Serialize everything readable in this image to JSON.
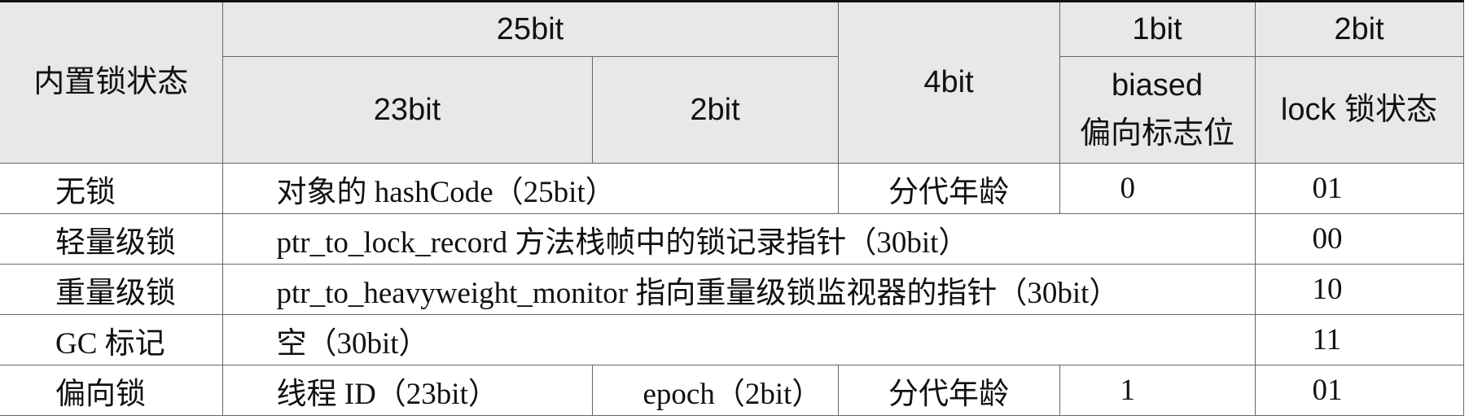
{
  "header": {
    "state_label": "内置锁状态",
    "bits_25": "25bit",
    "bits_23": "23bit",
    "bits_2_sub": "2bit",
    "bits_4": "4bit",
    "bits_1": "1bit",
    "biased_en": "biased",
    "biased_cn": "偏向标志位",
    "bits_2_lock": "2bit",
    "lock_label": "lock 锁状态"
  },
  "rows": [
    {
      "state": "无锁",
      "content": "对象的 hashCode（25bit）",
      "age": "分代年龄",
      "biased": "0",
      "lock": "01"
    },
    {
      "state": "轻量级锁",
      "content": "ptr_to_lock_record 方法栈帧中的锁记录指针（30bit）",
      "lock": "00"
    },
    {
      "state": "重量级锁",
      "content": "ptr_to_heavyweight_monitor 指向重量级锁监视器的指针（30bit）",
      "lock": "10"
    },
    {
      "state": "GC 标记",
      "content": "空（30bit）",
      "lock": "11"
    },
    {
      "state": "偏向锁",
      "thread_id": "线程 ID（23bit）",
      "epoch": "epoch（2bit）",
      "age": "分代年龄",
      "biased": "1",
      "lock": "01"
    }
  ]
}
